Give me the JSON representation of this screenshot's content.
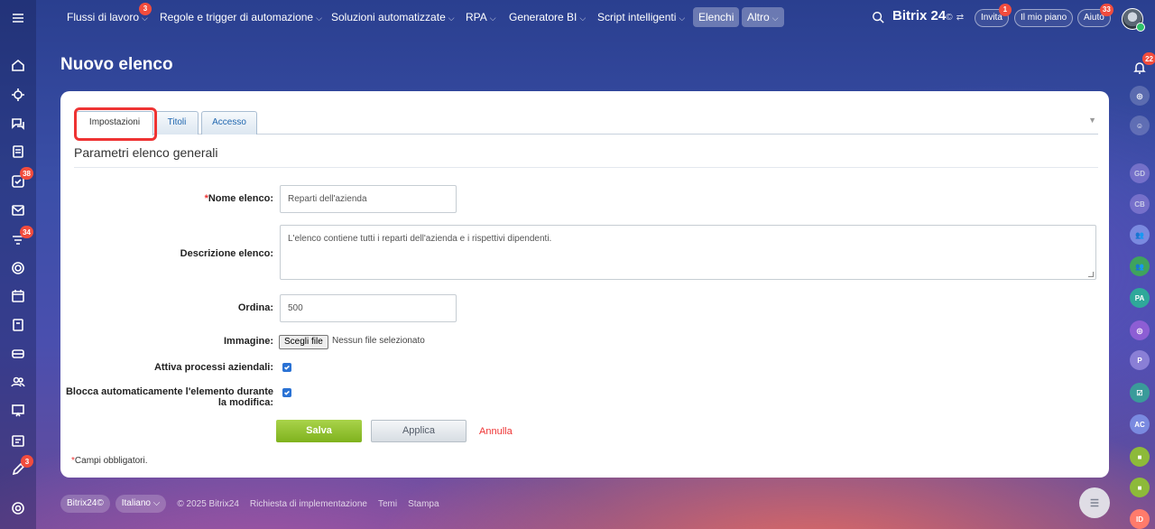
{
  "topnav": {
    "items": [
      {
        "label": "Flussi di lavoro",
        "badge": "3"
      },
      {
        "label": "Regole e trigger di automazione"
      },
      {
        "label": "Soluzioni automatizzate"
      },
      {
        "label": "RPA"
      },
      {
        "label": "Generatore BI"
      },
      {
        "label": "Script intelligenti"
      },
      {
        "label": "Elenchi"
      },
      {
        "label": "Altro"
      }
    ],
    "brand": "Bitrix 24",
    "brand_suffix": "©",
    "invite_label": "Invita",
    "invite_badge": "1",
    "plan_label": "Il mio piano",
    "help_label": "Aiuto",
    "help_badge": "33"
  },
  "left_rail": {
    "badges": {
      "tasks": "38",
      "feed": "34",
      "bottom": "3"
    }
  },
  "right_rail": {
    "notifications_badge": "22",
    "avatars": [
      "GD",
      "CB",
      "PA",
      "P",
      "AC",
      "ID"
    ],
    "colors": [
      "#8a7fd6",
      "#8a7fd6",
      "#7a8ae0",
      "#3fa35d",
      "#2fa89a",
      "#8d5ed4",
      "#8a7fd6",
      "#3a9b9a",
      "#7a8ae0",
      "#8dba3a",
      "#8dba3a",
      "#ff7b6b"
    ]
  },
  "page": {
    "title": "Nuovo elenco"
  },
  "tabs": [
    {
      "label": "Impostazioni",
      "active": true
    },
    {
      "label": "Titoli",
      "active": false
    },
    {
      "label": "Accesso",
      "active": false
    }
  ],
  "form": {
    "section_title": "Parametri elenco generali",
    "required_mark": "*",
    "name_label": "Nome elenco:",
    "name_value": "Reparti  dell'azienda",
    "description_label": "Descrizione elenco:",
    "description_value": "L'elenco contiene tutti i reparti dell'azienda e i rispettivi dipendenti.",
    "sort_label": "Ordina:",
    "sort_value": "500",
    "image_label": "Immagine:",
    "file_button": "Scegli file",
    "file_none": "Nessun file selezionato",
    "bizproc_label": "Attiva processi aziendali:",
    "bizproc_checked": true,
    "lock_label_1": "Blocca automaticamente l'elemento durante",
    "lock_label_2": "la modifica:",
    "lock_checked": true,
    "save_label": "Salva",
    "apply_label": "Applica",
    "cancel_label": "Annulla",
    "required_note": "Campi obbligatori."
  },
  "footer": {
    "brand": "Bitrix24",
    "brand_suffix": "©",
    "language": "Italiano",
    "copyright": "© 2025 Bitrix24",
    "implementation": "Richiesta di implementazione",
    "themes": "Temi",
    "print": "Stampa"
  },
  "colors": {
    "accent_green": "#7fb21e",
    "badge_red": "#f24c3d",
    "link_blue": "#2067b0",
    "cancel_red": "#e33"
  }
}
